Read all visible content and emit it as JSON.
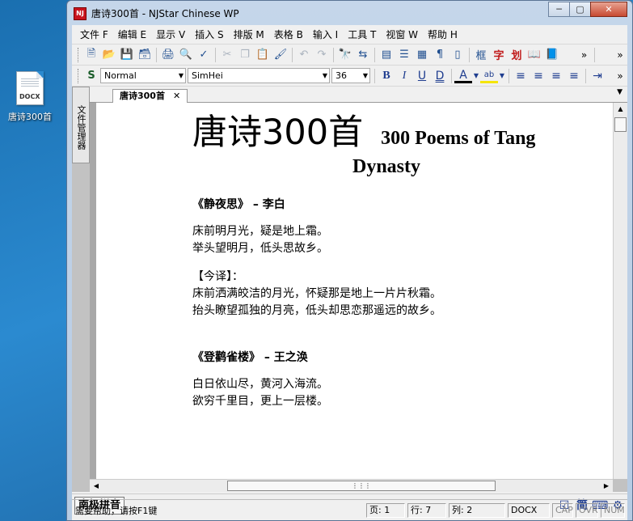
{
  "desktop": {
    "icon_badge": "DOCX",
    "icon_label": "唐诗300首"
  },
  "window": {
    "title": "唐诗300首 - NJStar Chinese WP",
    "app_icon_text": "NJ"
  },
  "menu": [
    "文件 F",
    "编辑 E",
    "显示 V",
    "插入 S",
    "排版 M",
    "表格 B",
    "输入 I",
    "工具 T",
    "视窗 W",
    "帮助 H"
  ],
  "format_bar": {
    "style": "Normal",
    "font": "SimHei",
    "size": "36"
  },
  "side_panel_label": "文件管理器",
  "doc_tab": {
    "label": "唐诗300首",
    "close": "✕"
  },
  "document": {
    "title_cn": "唐诗300首",
    "title_en_line1": "300 Poems of Tang",
    "title_en_line2": "Dynasty",
    "poem1": {
      "heading": "《静夜思》 – 李白",
      "lines": [
        "床前明月光，疑是地上霜。",
        "举头望明月，低头思故乡。"
      ],
      "trans_label": "【今译】：",
      "trans": [
        "床前洒满皎洁的月光，怀疑那是地上一片片秋霜。",
        "抬头瞭望孤独的月亮，低头却思恋那遥远的故乡。"
      ]
    },
    "poem2": {
      "heading": "《登鹳雀楼》 – 王之涣",
      "lines": [
        "白日依山尽，黄河入海流。",
        "欲穷千里目，更上一层楼。"
      ]
    }
  },
  "ime": {
    "label": "南极拼音",
    "mode": "简"
  },
  "status": {
    "help": "需要帮助，请按F1键",
    "page": "页: 1",
    "row": "行: 7",
    "col": "列: 2",
    "doctype": "DOCX",
    "cap": "CAP",
    "ovr": "OVR",
    "num": "NUM"
  }
}
